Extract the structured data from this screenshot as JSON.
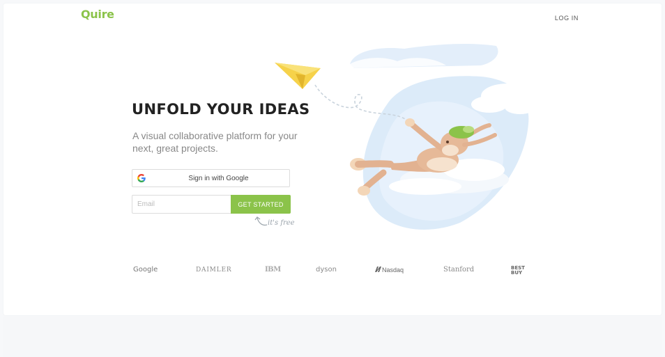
{
  "header": {
    "logo_text": "Quire",
    "login_label": "LOG IN"
  },
  "hero": {
    "headline": "UNFOLD YOUR IDEAS",
    "subtitle": "A visual collaborative platform for your next, great projects."
  },
  "signup": {
    "google_button_label": "Sign in with Google",
    "email_placeholder": "Email",
    "email_value": "",
    "cta_label": "GET STARTED",
    "free_note": "it's free"
  },
  "customers": {
    "logos": [
      "Google",
      "DAIMLER",
      "IBM",
      "dyson",
      "Nasdaq",
      "Stanford",
      "BEST BUY"
    ]
  },
  "colors": {
    "brand_green": "#8bc34a",
    "headline": "#222222",
    "subtitle": "#888888",
    "sky_blue": "#dcebf9"
  },
  "icons": {
    "google": "google-g-icon",
    "paper_plane": "paper-plane-icon",
    "arrow": "curved-arrow-icon",
    "nasdaq": "nasdaq-n-icon"
  }
}
